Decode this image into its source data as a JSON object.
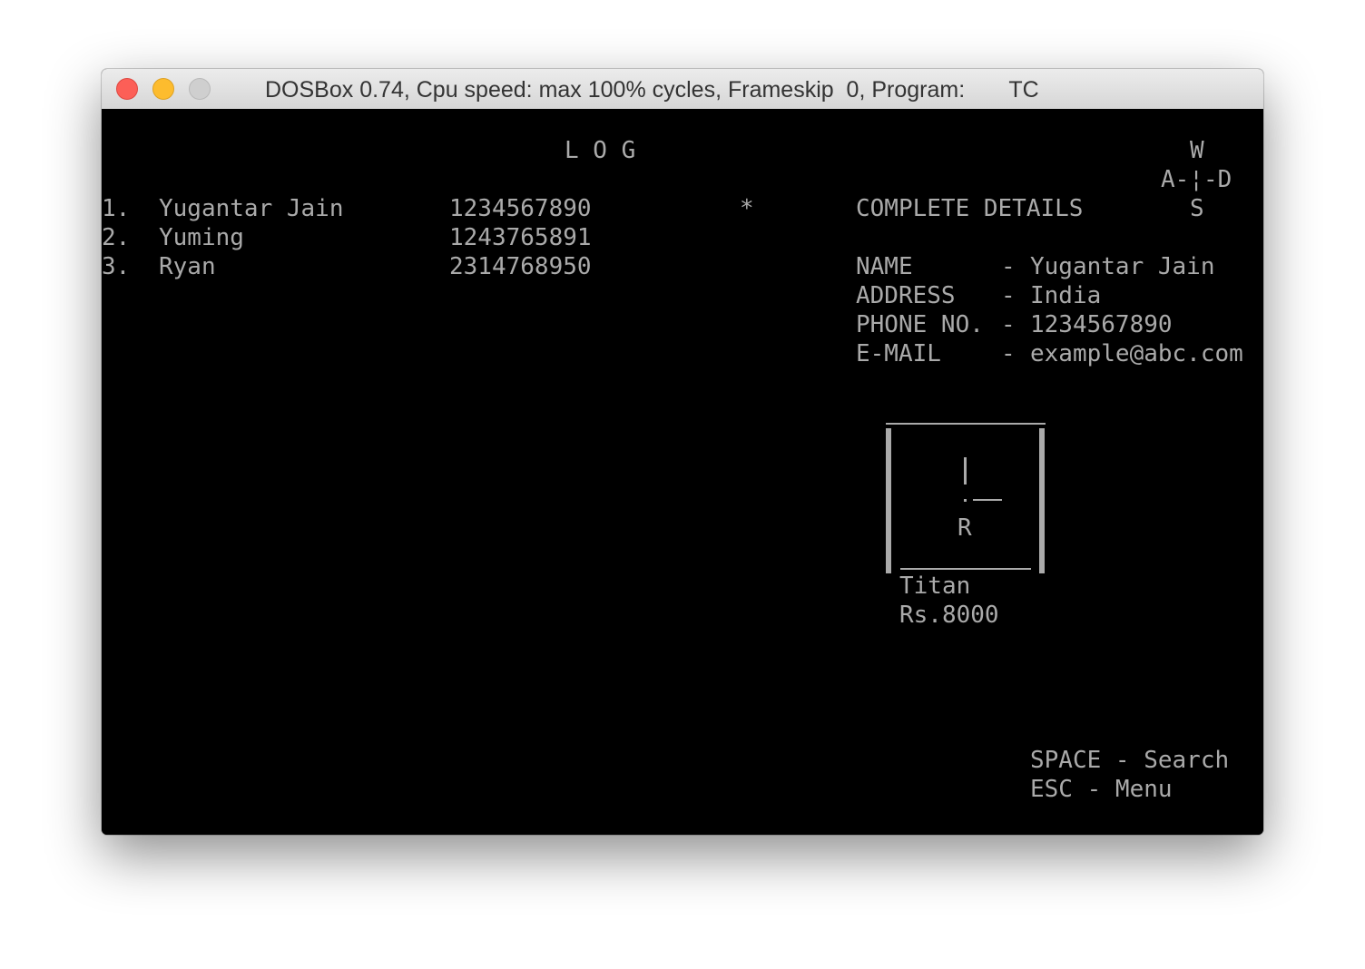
{
  "window": {
    "title": "DOSBox 0.74, Cpu speed: max 100% cycles, Frameskip  0, Program:       TC"
  },
  "log": {
    "heading": "L O G",
    "entries": [
      {
        "index": "1.",
        "name": "Yugantar Jain",
        "phone": "1234567890"
      },
      {
        "index": "2.",
        "name": "Yuming",
        "phone": "1243765891"
      },
      {
        "index": "3.",
        "name": "Ryan",
        "phone": "2314768950"
      }
    ],
    "selection_marker": "*"
  },
  "controls_hint": {
    "up": "W",
    "left_right": "A-¦-D",
    "down": "S"
  },
  "details": {
    "heading": "COMPLETE DETAILS",
    "rows": [
      {
        "label": "NAME",
        "sep": "-",
        "value": "Yugantar Jain"
      },
      {
        "label": "ADDRESS",
        "sep": "-",
        "value": "India"
      },
      {
        "label": "PHONE NO.",
        "sep": "-",
        "value": "1234567890"
      },
      {
        "label": "E-MAIL",
        "sep": "-",
        "value": "example@abc.com"
      }
    ]
  },
  "product": {
    "logo_letter": "R",
    "name": "Titan",
    "price": "Rs.8000"
  },
  "footer": {
    "search_hint": "SPACE - Search",
    "menu_hint": "ESC - Menu"
  },
  "colors": {
    "screen_bg": "#000000",
    "screen_text": "#aaaaaa",
    "close": "#fc5f57",
    "minimize": "#fdbc2e",
    "maximize": "#cfcfcf"
  }
}
